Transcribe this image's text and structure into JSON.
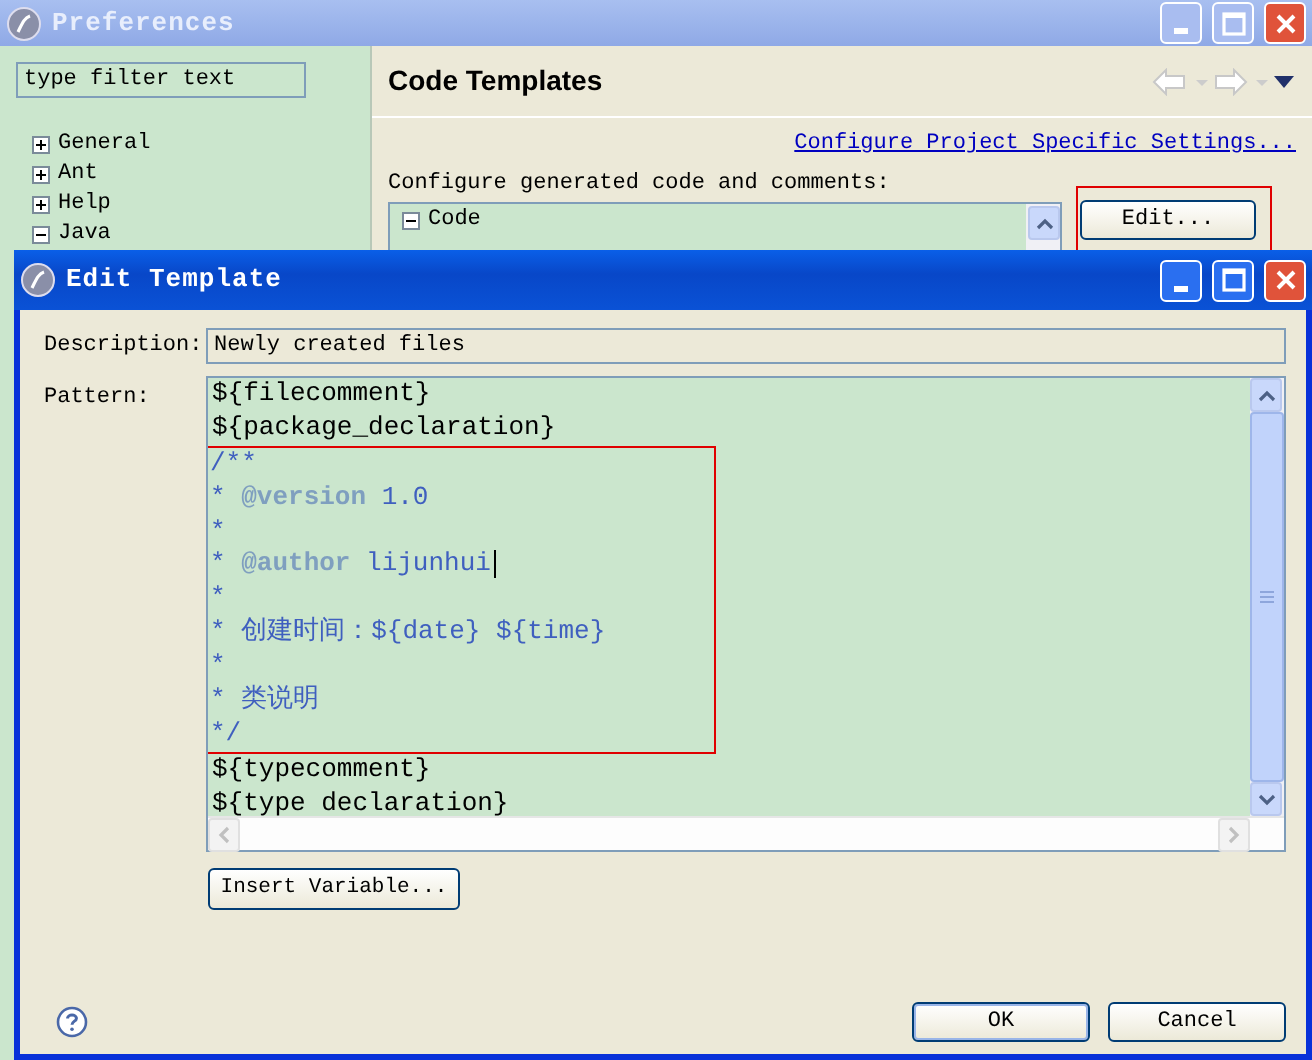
{
  "preferences_window": {
    "title": "Preferences",
    "filter": {
      "value": "type filter text"
    },
    "tree": [
      {
        "label": "General",
        "expanded": false
      },
      {
        "label": "Ant",
        "expanded": false
      },
      {
        "label": "Help",
        "expanded": false
      },
      {
        "label": "Java",
        "expanded": true
      }
    ],
    "header": "Code Templates",
    "link": "Configure Project Specific Settings...",
    "label": "Configure generated code and comments:",
    "templates_tree": [
      {
        "label": "Code",
        "expanded": true
      }
    ],
    "edit_button": {
      "label": "Edit...",
      "highlighted": true
    }
  },
  "edit_template_dialog": {
    "title": "Edit Template",
    "description_label": "Description:",
    "description": "Newly created files",
    "pattern_label": "Pattern:",
    "pattern_blocks": [
      {
        "highlighted": false,
        "lines": [
          {
            "cursor": false,
            "segments": [
              {
                "kind": "code",
                "text": "${filecomment}"
              }
            ]
          },
          {
            "cursor": false,
            "segments": [
              {
                "kind": "code",
                "text": "${package_declaration}"
              }
            ]
          }
        ]
      },
      {
        "highlighted": true,
        "lines": [
          {
            "cursor": false,
            "segments": [
              {
                "kind": "comment",
                "text": "/**"
              }
            ]
          },
          {
            "cursor": false,
            "segments": [
              {
                "kind": "comment",
                "text": "* "
              },
              {
                "kind": "tag",
                "text": "@version"
              },
              {
                "kind": "comment",
                "text": " 1.0"
              }
            ]
          },
          {
            "cursor": false,
            "segments": [
              {
                "kind": "comment",
                "text": "*"
              }
            ]
          },
          {
            "cursor": true,
            "segments": [
              {
                "kind": "comment",
                "text": "* "
              },
              {
                "kind": "tag",
                "text": "@author"
              },
              {
                "kind": "comment",
                "text": " lijunhui"
              }
            ]
          },
          {
            "cursor": false,
            "segments": [
              {
                "kind": "comment",
                "text": "*"
              }
            ]
          },
          {
            "cursor": false,
            "segments": [
              {
                "kind": "comment",
                "text": "* 创建时间：${date} ${time}"
              }
            ]
          },
          {
            "cursor": false,
            "segments": [
              {
                "kind": "comment",
                "text": "*"
              }
            ]
          },
          {
            "cursor": false,
            "segments": [
              {
                "kind": "comment",
                "text": "* 类说明"
              }
            ]
          },
          {
            "cursor": false,
            "segments": [
              {
                "kind": "comment",
                "text": "*/"
              }
            ]
          }
        ]
      },
      {
        "highlighted": false,
        "lines": [
          {
            "cursor": false,
            "segments": [
              {
                "kind": "code",
                "text": "${typecomment}"
              }
            ]
          },
          {
            "cursor": false,
            "segments": [
              {
                "kind": "code",
                "text": "${type declaration}"
              }
            ]
          }
        ]
      }
    ],
    "insert_button": "Insert Variable...",
    "ok_button": "OK",
    "cancel_button": "Cancel"
  }
}
